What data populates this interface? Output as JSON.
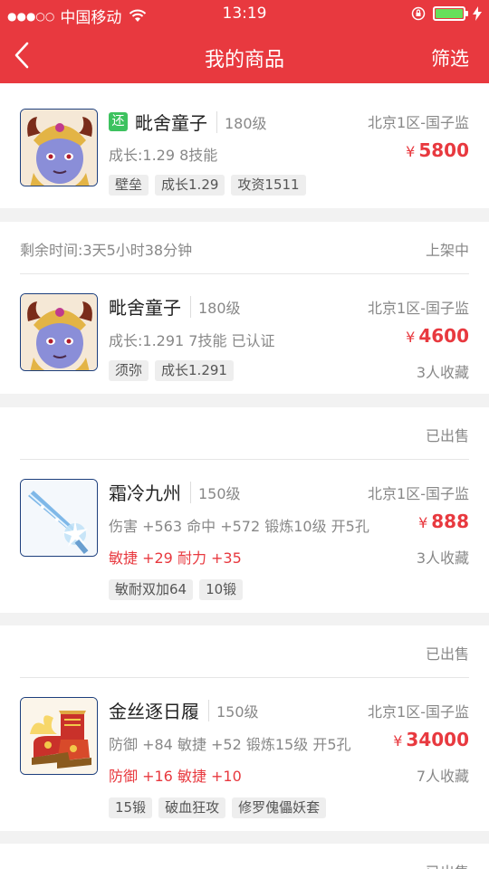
{
  "status_bar": {
    "carrier": "中国移动",
    "time": "13:19"
  },
  "nav": {
    "title": "我的商品",
    "filter": "筛选"
  },
  "items": [
    {
      "name": "毗舍童子",
      "badge": "还",
      "level": "180级",
      "server": "北京1区-国子监",
      "currency": "¥",
      "price": "5800",
      "desc1": "成长:1.29 8技能",
      "tags": [
        "壁垒",
        "成长1.29",
        "攻资1511"
      ]
    },
    {
      "remain": "剩余时间:3天5小时38分钟",
      "status": "上架中",
      "name": "毗舍童子",
      "level": "180级",
      "server": "北京1区-国子监",
      "currency": "¥",
      "price": "4600",
      "desc1": "成长:1.291 7技能 已认证",
      "favorites": "3人收藏",
      "tags": [
        "须弥",
        "成长1.291"
      ]
    },
    {
      "status": "已出售",
      "name": "霜冷九州",
      "level": "150级",
      "server": "北京1区-国子监",
      "currency": "¥",
      "price": "888",
      "desc1": "伤害 +563 命中 +572 锻炼10级 开5孔",
      "desc2": "敏捷 +29 耐力 +35",
      "favorites": "3人收藏",
      "tags": [
        "敏耐双加64",
        "10锻"
      ]
    },
    {
      "status": "已出售",
      "name": "金丝逐日履",
      "level": "150级",
      "server": "北京1区-国子监",
      "currency": "¥",
      "price": "34000",
      "desc1": "防御 +84 敏捷 +52 锻炼15级 开5孔",
      "desc2": "防御 +16 敏捷 +10",
      "favorites": "7人收藏",
      "tags": [
        "15锻",
        "破血狂攻",
        "修罗傀儡妖套"
      ]
    },
    {
      "status": "已出售"
    }
  ]
}
